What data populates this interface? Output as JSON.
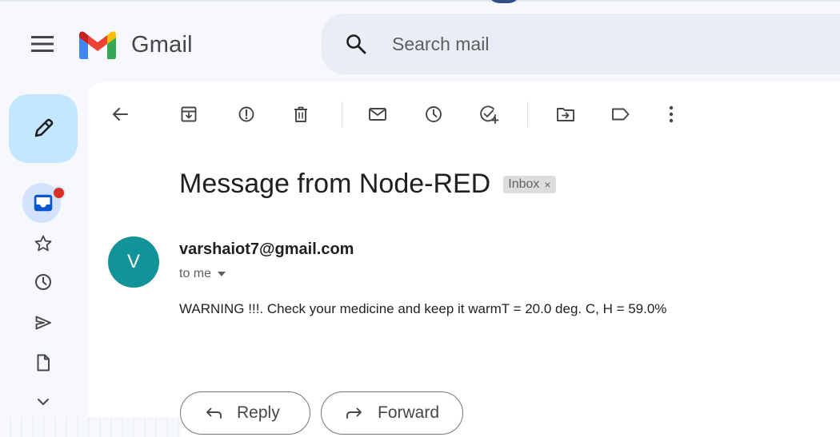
{
  "app": {
    "name": "Gmail"
  },
  "search": {
    "placeholder": "Search mail"
  },
  "toolbar": {
    "icons": [
      "back-arrow-icon",
      "archive-icon",
      "report-spam-icon",
      "delete-icon",
      "mark-unread-icon",
      "snooze-icon",
      "add-task-icon",
      "move-to-icon",
      "label-icon",
      "more-vert-icon"
    ]
  },
  "message": {
    "subject": "Message from Node-RED",
    "label": "Inbox",
    "label_remove": "×",
    "avatar_initial": "V",
    "sender": "varshaiot7@gmail.com",
    "recipient": "to me",
    "body": "WARNING !!!. Check your medicine and keep it warmT = 20.0 deg. C, H = 59.0%"
  },
  "actions": {
    "reply": "Reply",
    "forward": "Forward"
  },
  "colors": {
    "compose_bg": "#c2e7ff",
    "search_bg": "#e9eef6",
    "avatar_bg": "#12939a",
    "badge": "#d93025",
    "background": "#f6f8fc"
  }
}
